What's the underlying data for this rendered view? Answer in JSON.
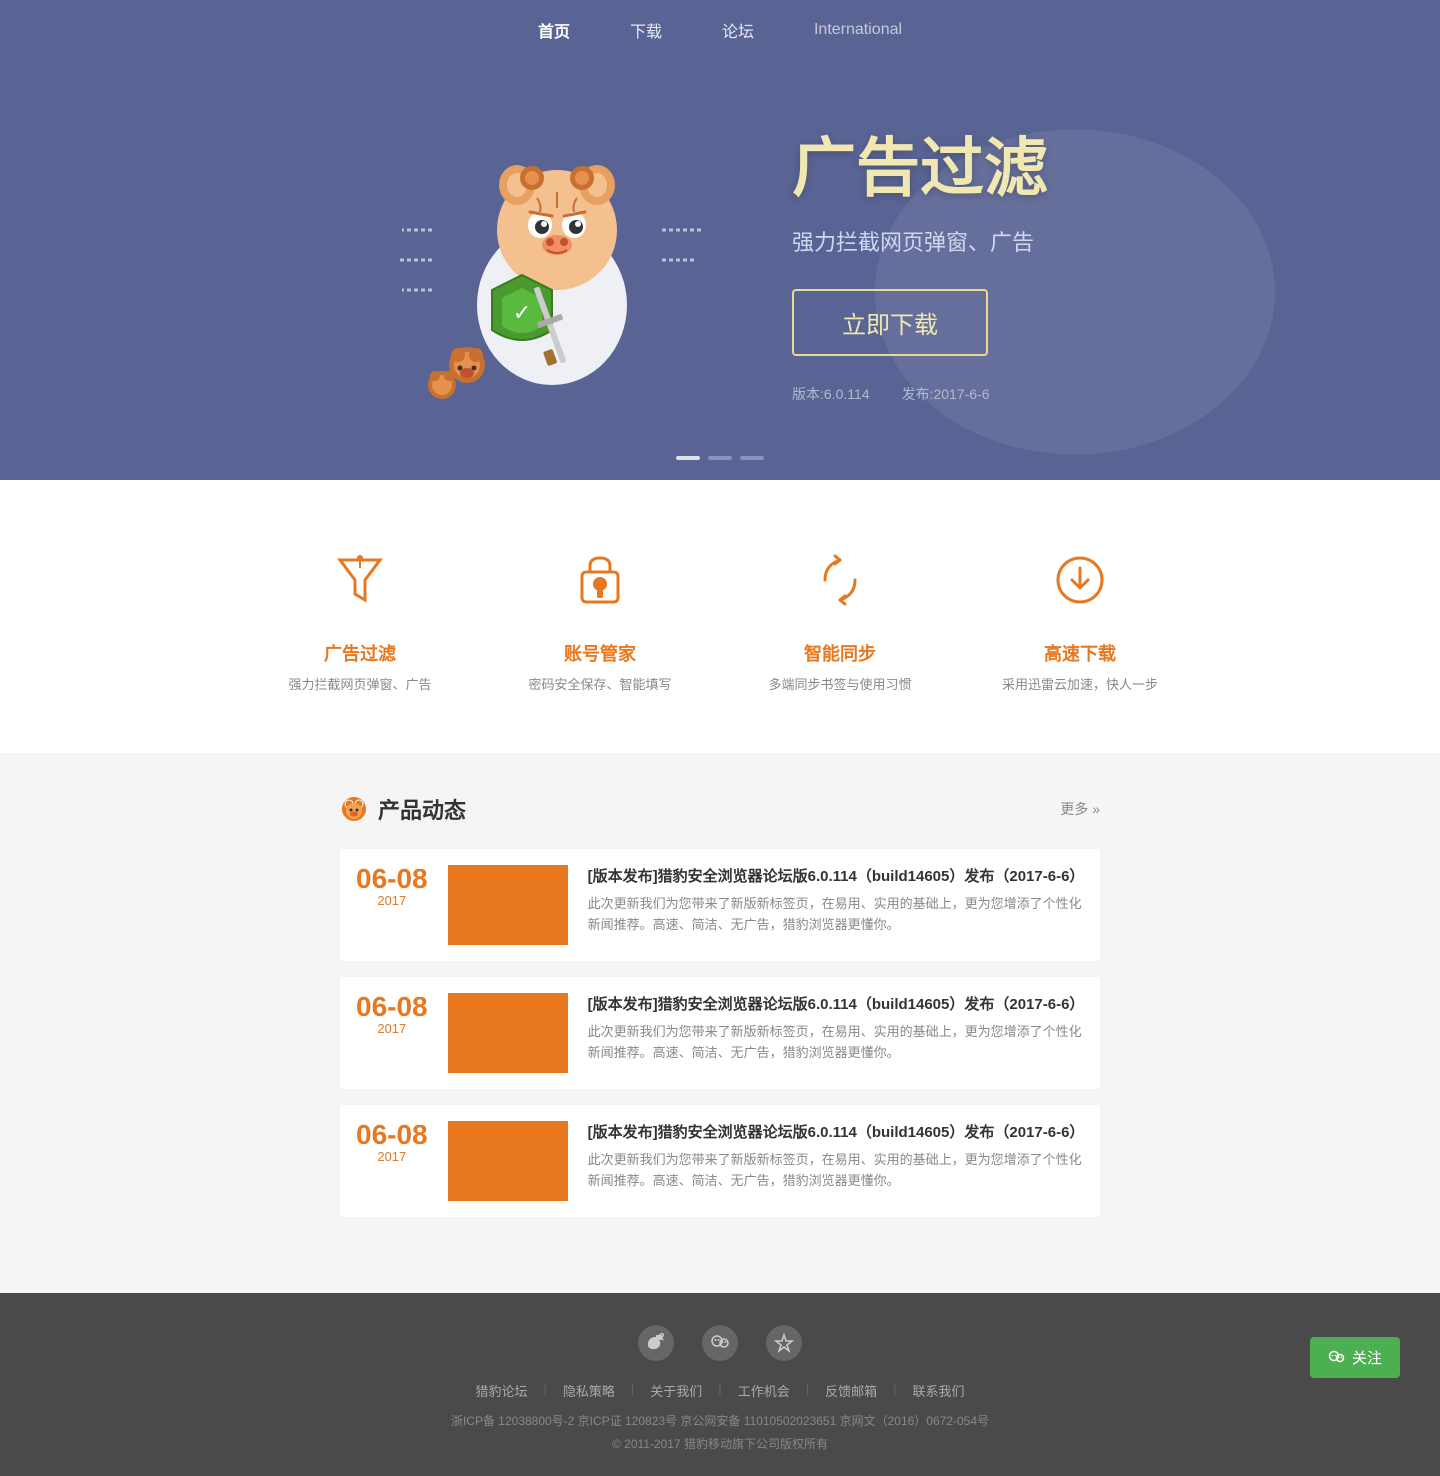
{
  "nav": {
    "items": [
      {
        "label": "首页",
        "active": true
      },
      {
        "label": "下载",
        "active": false
      },
      {
        "label": "论坛",
        "active": false
      },
      {
        "label": "International",
        "active": false
      }
    ]
  },
  "hero": {
    "title": "广告过滤",
    "subtitle": "强力拦截网页弹窗、广告",
    "download_btn": "立即下载",
    "version_label": "版本:6.0.114",
    "release_label": "发布:2017-6-6"
  },
  "features": [
    {
      "name": "广告过滤",
      "desc": "强力拦截网页弹窗、广告",
      "icon": "filter"
    },
    {
      "name": "账号管家",
      "desc": "密码安全保存、智能填写",
      "icon": "account"
    },
    {
      "name": "智能同步",
      "desc": "多端同步书签与使用习惯",
      "icon": "sync"
    },
    {
      "name": "高速下载",
      "desc": "采用迅雷云加速，快人一步",
      "icon": "download"
    }
  ],
  "news": {
    "section_title": "产品动态",
    "more_label": "更多",
    "items": [
      {
        "date_day": "06-08",
        "date_year": "2017",
        "title": "[版本发布]猎豹安全浏览器论坛版6.0.114（build14605）发布（2017-6-6）",
        "desc": "此次更新我们为您带来了新版新标签页，在易用、实用的基础上，更为您增添了个性化新闻推荐。高速、简洁、无广告，猎豹浏览器更懂你。"
      },
      {
        "date_day": "06-08",
        "date_year": "2017",
        "title": "[版本发布]猎豹安全浏览器论坛版6.0.114（build14605）发布（2017-6-6）",
        "desc": "此次更新我们为您带来了新版新标签页，在易用、实用的基础上，更为您增添了个性化新闻推荐。高速、简洁、无广告，猎豹浏览器更懂你。"
      },
      {
        "date_day": "06-08",
        "date_year": "2017",
        "title": "[版本发布]猎豹安全浏览器论坛版6.0.114（build14605）发布（2017-6-6）",
        "desc": "此次更新我们为您带来了新版新标签页，在易用、实用的基础上，更为您增添了个性化新闻推荐。高速、简洁、无广告，猎豹浏览器更懂你。"
      }
    ]
  },
  "footer": {
    "links": [
      "猎豹论坛",
      "隐私策略",
      "关于我们",
      "工作机会",
      "反馈邮箱",
      "联系我们"
    ],
    "icp": "浙ICP备 12038800号-2  京ICP证 120823号  京公网安备 11010502023651  京网文（2016）0672-054号",
    "copyright": "© 2011-2017 猎豹移动旗下公司版权所有"
  },
  "wechat": {
    "label": "关注"
  }
}
